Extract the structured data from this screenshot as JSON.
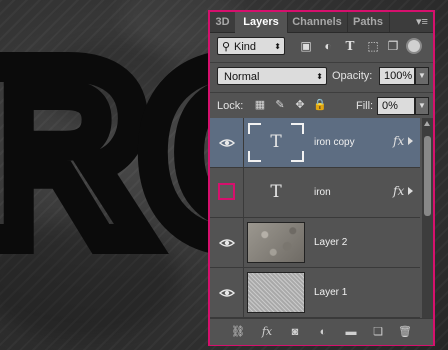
{
  "canvas": {
    "text": "RO"
  },
  "panel": {
    "tabs": [
      {
        "label": "3D",
        "active": false
      },
      {
        "label": "Layers",
        "active": true
      },
      {
        "label": "Channels",
        "active": false
      },
      {
        "label": "Paths",
        "active": false
      }
    ],
    "filter": {
      "kind_label": "Kind"
    },
    "blend_mode": "Normal",
    "opacity_label": "Opacity:",
    "opacity_value": "100%",
    "lock_label": "Lock:",
    "fill_label": "Fill:",
    "fill_value": "0%",
    "layers": [
      {
        "name": "iron copy",
        "type": "text",
        "visible": true,
        "selected": true,
        "fx": "fx"
      },
      {
        "name": "iron",
        "type": "text",
        "visible": false,
        "selected": false,
        "fx": "fx"
      },
      {
        "name": "Layer 2",
        "type": "stone",
        "visible": true,
        "selected": false
      },
      {
        "name": "Layer 1",
        "type": "pattern",
        "visible": true,
        "selected": false
      }
    ],
    "text_thumb_glyph": "T",
    "colors": {
      "highlight": "#d6106d",
      "selected_row": "#5d6d82"
    }
  }
}
